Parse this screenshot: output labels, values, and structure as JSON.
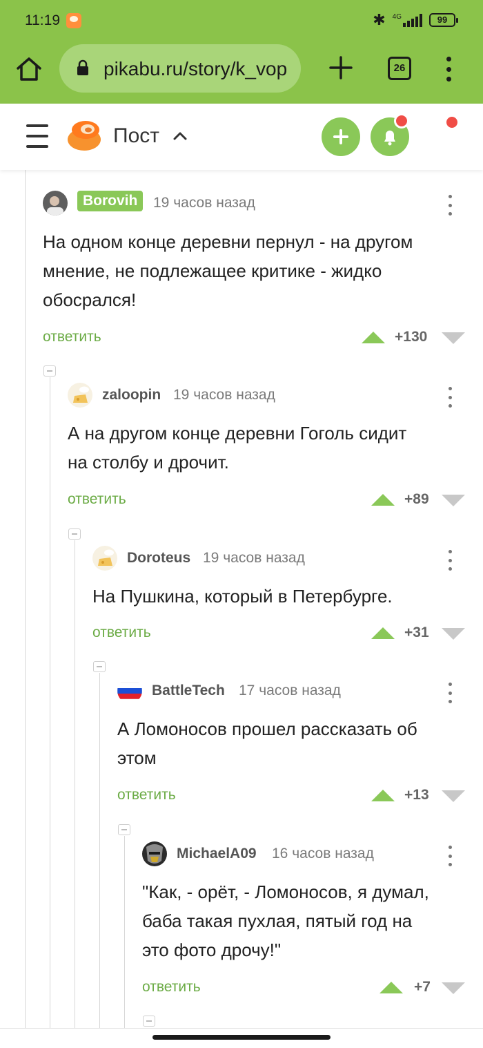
{
  "status_bar": {
    "time": "11:19",
    "network": "4G",
    "battery": "99",
    "icons": [
      "pikabu-app-icon",
      "bluetooth-icon",
      "signal-icon",
      "battery-icon"
    ]
  },
  "browser": {
    "url": "pikabu.ru/story/k_vop",
    "tab_count": "26",
    "toolbar_color": "#8bc34a"
  },
  "header": {
    "title": "Пост",
    "accent_color": "#8ac858",
    "notification_color": "#f04d46"
  },
  "comments": [
    {
      "author": "Borovih",
      "time": "19 часов назад",
      "lines": [
        "На одном конце деревни пернул - на другом",
        "мнение, не подлежащее критике - жидко",
        "обосрался!"
      ],
      "reply": "ответить",
      "rating": "+130"
    },
    {
      "author": "zaloopin",
      "time": "19 часов назад",
      "lines": [
        "А на другом конце деревни Гоголь сидит",
        "на столбу и дрочит."
      ],
      "reply": "ответить",
      "rating": "+89"
    },
    {
      "author": "Doroteus",
      "time": "19 часов назад",
      "lines": [
        "На Пушкина, который в Петербурге."
      ],
      "reply": "ответить",
      "rating": "+31"
    },
    {
      "author": "BattleTech",
      "time": "17 часов назад",
      "lines": [
        "А Ломоносов прошел рассказать об",
        "этом"
      ],
      "reply": "ответить",
      "rating": "+13"
    },
    {
      "author": "MichaelA09",
      "time": "16 часов назад",
      "lines": [
        "\"Как, - орёт, - Ломоносов, я думал,",
        "баба такая пухлая, пятый год на",
        "это фото дрочу!\""
      ],
      "reply": "ответить",
      "rating": "+7"
    }
  ]
}
